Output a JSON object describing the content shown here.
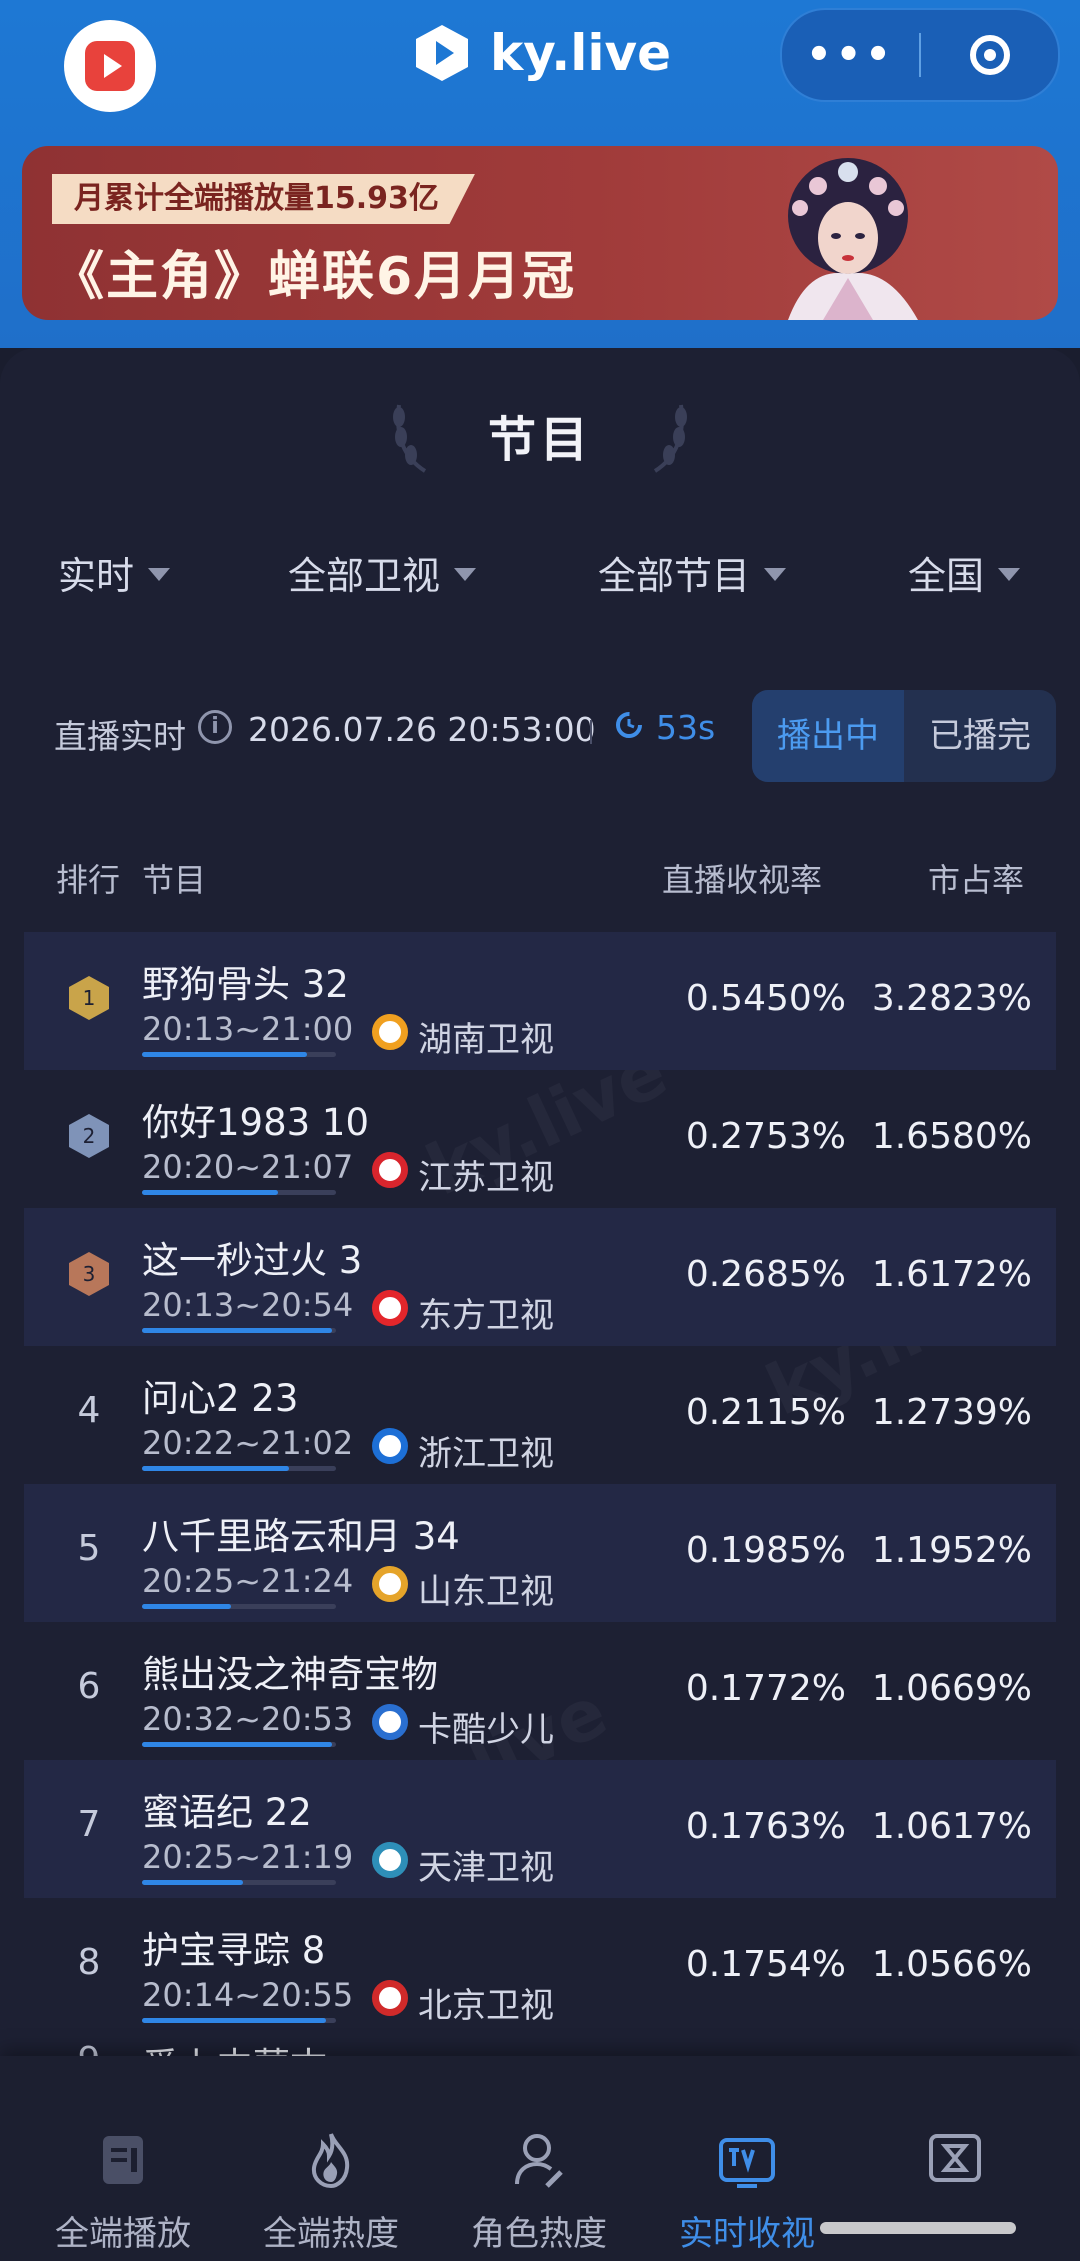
{
  "header": {
    "brand": "ky.live",
    "menu_dots": "•••"
  },
  "banner": {
    "tag": "月累计全端播放量15.93亿",
    "title": "《主角》蝉联6月月冠"
  },
  "section": {
    "title": "节目"
  },
  "filters": [
    {
      "label": "实时"
    },
    {
      "label": "全部卫视"
    },
    {
      "label": "全部节目"
    },
    {
      "label": "全国"
    }
  ],
  "status": {
    "live_label": "直播实时",
    "info_glyph": "i",
    "timestamp": "2026.07.26 20:53:00",
    "countdown": "53s",
    "tabs": {
      "airing": "播出中",
      "finished": "已播完"
    }
  },
  "table": {
    "headers": {
      "rank": "排行",
      "program": "节目",
      "rating": "直播收视率",
      "share": "市占率"
    },
    "rows": [
      {
        "rank": "1",
        "name": "野狗骨头 32",
        "time": "20:13~21:00",
        "channel": "湖南卫视",
        "rating": "0.5450%",
        "share": "3.2823%",
        "progress": 0.85,
        "channel_color": "#f0a020"
      },
      {
        "rank": "2",
        "name": "你好1983 10",
        "time": "20:20~21:07",
        "channel": "江苏卫视",
        "rating": "0.2753%",
        "share": "1.6580%",
        "progress": 0.7,
        "channel_color": "#d8252d"
      },
      {
        "rank": "3",
        "name": "这一秒过火 3",
        "time": "20:13~20:54",
        "channel": "东方卫视",
        "rating": "0.2685%",
        "share": "1.6172%",
        "progress": 0.98,
        "channel_color": "#e3262b"
      },
      {
        "rank": "4",
        "name": "问心2 23",
        "time": "20:22~21:02",
        "channel": "浙江卫视",
        "rating": "0.2115%",
        "share": "1.2739%",
        "progress": 0.76,
        "channel_color": "#1d6fd6"
      },
      {
        "rank": "5",
        "name": "八千里路云和月 34",
        "time": "20:25~21:24",
        "channel": "山东卫视",
        "rating": "0.1985%",
        "share": "1.1952%",
        "progress": 0.46,
        "channel_color": "#e5a42a"
      },
      {
        "rank": "6",
        "name": "熊出没之神奇宝物",
        "time": "20:32~20:53",
        "channel": "卡酷少儿",
        "rating": "0.1772%",
        "share": "1.0669%",
        "progress": 0.98,
        "channel_color": "#2a6fd0"
      },
      {
        "rank": "7",
        "name": "蜜语纪 22",
        "time": "20:25~21:19",
        "channel": "天津卫视",
        "rating": "0.1763%",
        "share": "1.0617%",
        "progress": 0.52,
        "channel_color": "#2e8fb8"
      },
      {
        "rank": "8",
        "name": "护宝寻踪 8",
        "time": "20:14~20:55",
        "channel": "北京卫视",
        "rating": "0.1754%",
        "share": "1.0566%",
        "progress": 0.95,
        "channel_color": "#d02a2a"
      }
    ],
    "partial_row_name": "爱上内蒙古"
  },
  "nav": [
    {
      "label": "全端播放"
    },
    {
      "label": "全端热度"
    },
    {
      "label": "角色热度"
    },
    {
      "label": "实时收视"
    }
  ],
  "colors": {
    "accent": "#3f8ee8",
    "header_blue": "#1e78d4",
    "background": "#1d2033"
  }
}
